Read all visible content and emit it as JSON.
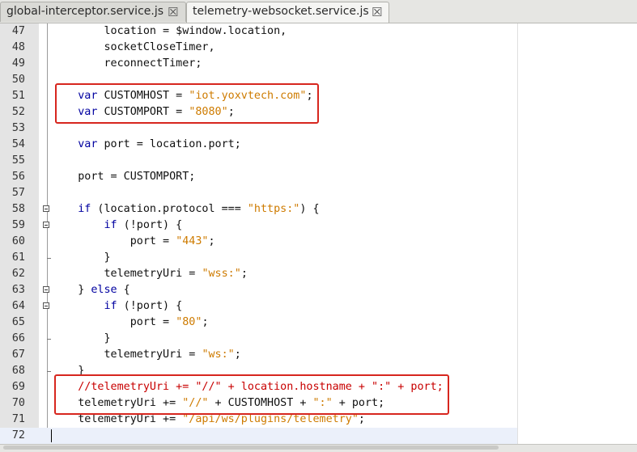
{
  "tabs": [
    {
      "label": "global-interceptor.service.js",
      "close": "☒",
      "active": false
    },
    {
      "label": "telemetry-websocket.service.js",
      "close": "☒",
      "active": true
    }
  ],
  "lines": [
    {
      "n": "47",
      "parts": [
        {
          "t": "        location = $window.location,",
          "c": "p"
        }
      ]
    },
    {
      "n": "48",
      "parts": [
        {
          "t": "        socketCloseTimer,",
          "c": "p"
        }
      ]
    },
    {
      "n": "49",
      "parts": [
        {
          "t": "        reconnectTimer;",
          "c": "p"
        }
      ]
    },
    {
      "n": "50",
      "parts": []
    },
    {
      "n": "51",
      "parts": [
        {
          "t": "    ",
          "c": "p"
        },
        {
          "t": "var",
          "c": "kw"
        },
        {
          "t": " CUSTOMHOST = ",
          "c": "p"
        },
        {
          "t": "\"iot.yoxvtech.com\"",
          "c": "str"
        },
        {
          "t": ";",
          "c": "p"
        }
      ]
    },
    {
      "n": "52",
      "parts": [
        {
          "t": "    ",
          "c": "p"
        },
        {
          "t": "var",
          "c": "kw"
        },
        {
          "t": " CUSTOMPORT = ",
          "c": "p"
        },
        {
          "t": "\"8080\"",
          "c": "str"
        },
        {
          "t": ";",
          "c": "p"
        }
      ]
    },
    {
      "n": "53",
      "parts": []
    },
    {
      "n": "54",
      "parts": [
        {
          "t": "    ",
          "c": "p"
        },
        {
          "t": "var",
          "c": "kw"
        },
        {
          "t": " port = location.port;",
          "c": "p"
        }
      ]
    },
    {
      "n": "55",
      "parts": []
    },
    {
      "n": "56",
      "parts": [
        {
          "t": "    port = CUSTOMPORT;",
          "c": "p"
        }
      ]
    },
    {
      "n": "57",
      "parts": []
    },
    {
      "n": "58",
      "fold": "open",
      "parts": [
        {
          "t": "    ",
          "c": "p"
        },
        {
          "t": "if",
          "c": "kw"
        },
        {
          "t": " (location.protocol === ",
          "c": "p"
        },
        {
          "t": "\"https:\"",
          "c": "str"
        },
        {
          "t": ") {",
          "c": "p"
        }
      ]
    },
    {
      "n": "59",
      "fold": "open",
      "parts": [
        {
          "t": "        ",
          "c": "p"
        },
        {
          "t": "if",
          "c": "kw"
        },
        {
          "t": " (!port) {",
          "c": "p"
        }
      ]
    },
    {
      "n": "60",
      "parts": [
        {
          "t": "            port = ",
          "c": "p"
        },
        {
          "t": "\"443\"",
          "c": "str"
        },
        {
          "t": ";",
          "c": "p"
        }
      ]
    },
    {
      "n": "61",
      "fold": "end",
      "parts": [
        {
          "t": "        }",
          "c": "p"
        }
      ]
    },
    {
      "n": "62",
      "parts": [
        {
          "t": "        telemetryUri = ",
          "c": "p"
        },
        {
          "t": "\"wss:\"",
          "c": "str"
        },
        {
          "t": ";",
          "c": "p"
        }
      ]
    },
    {
      "n": "63",
      "fold": "open",
      "parts": [
        {
          "t": "    } ",
          "c": "p"
        },
        {
          "t": "else",
          "c": "kw"
        },
        {
          "t": " {",
          "c": "p"
        }
      ]
    },
    {
      "n": "64",
      "fold": "open",
      "parts": [
        {
          "t": "        ",
          "c": "p"
        },
        {
          "t": "if",
          "c": "kw"
        },
        {
          "t": " (!port) {",
          "c": "p"
        }
      ]
    },
    {
      "n": "65",
      "parts": [
        {
          "t": "            port = ",
          "c": "p"
        },
        {
          "t": "\"80\"",
          "c": "str"
        },
        {
          "t": ";",
          "c": "p"
        }
      ]
    },
    {
      "n": "66",
      "fold": "end",
      "parts": [
        {
          "t": "        }",
          "c": "p"
        }
      ]
    },
    {
      "n": "67",
      "parts": [
        {
          "t": "        telemetryUri = ",
          "c": "p"
        },
        {
          "t": "\"ws:\"",
          "c": "str"
        },
        {
          "t": ";",
          "c": "p"
        }
      ]
    },
    {
      "n": "68",
      "fold": "end",
      "parts": [
        {
          "t": "    }",
          "c": "p"
        }
      ]
    },
    {
      "n": "69",
      "parts": [
        {
          "t": "    //telemetryUri += \"//\" + location.hostname + \":\" + port;",
          "c": "cmt"
        }
      ]
    },
    {
      "n": "70",
      "parts": [
        {
          "t": "    telemetryUri += ",
          "c": "p"
        },
        {
          "t": "\"//\"",
          "c": "str"
        },
        {
          "t": " + CUSTOMHOST + ",
          "c": "p"
        },
        {
          "t": "\":\"",
          "c": "str"
        },
        {
          "t": " + port;",
          "c": "p"
        }
      ]
    },
    {
      "n": "71",
      "parts": [
        {
          "t": "    telemetryUri += ",
          "c": "p"
        },
        {
          "t": "\"/api/ws/plugins/telemetry\"",
          "c": "str"
        },
        {
          "t": ";",
          "c": "p"
        }
      ]
    },
    {
      "n": "72",
      "parts": []
    }
  ],
  "highlights": [
    {
      "label": "custom-host-port-highlight",
      "from_line": "51",
      "to_line": "52",
      "color": "#d7261e"
    },
    {
      "label": "telemetry-uri-highlight",
      "from_line": "69",
      "to_line": "70",
      "color": "#d7261e"
    }
  ]
}
